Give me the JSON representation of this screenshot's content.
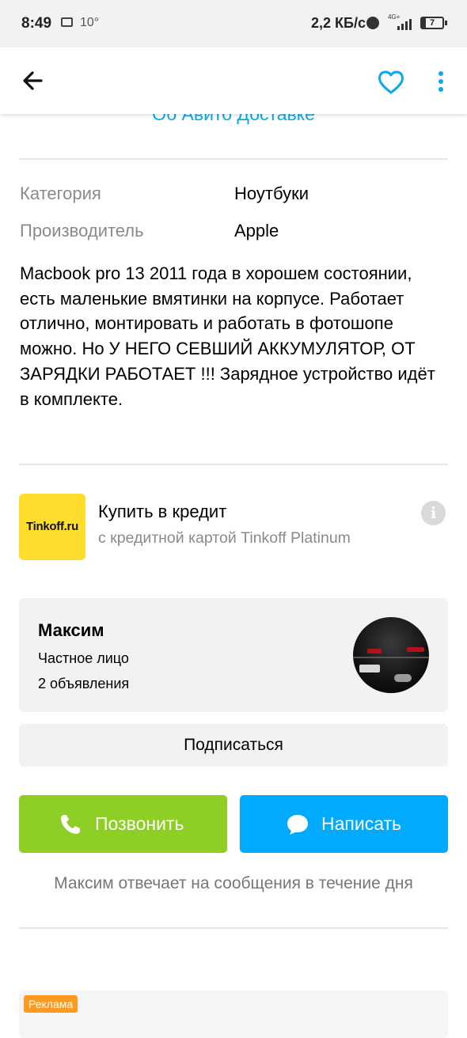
{
  "status_bar": {
    "time": "8:49",
    "temperature": "10°",
    "speed": "2,2 КБ/с",
    "network": "4G+",
    "battery": "7"
  },
  "header": {
    "back_icon": "arrow-left-icon",
    "favorite_icon": "heart-outline-icon",
    "more_icon": "more-vertical-icon",
    "accent_color": "#0aa9e8"
  },
  "delivery_link": "Об Авито Доставке",
  "params": [
    {
      "label": "Категория",
      "value": "Ноутбуки"
    },
    {
      "label": "Производитель",
      "value": "Apple"
    }
  ],
  "description": "Macbook pro 13 2011 года в хорошем состоянии, есть маленькие вмятинки на корпусе. Работает отлично, монтировать и работать в фотошопе можно. Но У НЕГО СЕВШИЙ АККУМУЛЯТОР, ОТ ЗАРЯДКИ РАБОТАЕТ !!! Зарядное устройство идёт в комплекте.",
  "credit": {
    "logo_text": "Tinkoff.ru",
    "title": "Купить в кредит",
    "subtitle": "с кредитной картой Tinkoff Platinum",
    "info_icon": "info-icon",
    "logo_color": "#ffdd2d"
  },
  "seller": {
    "name": "Максим",
    "type": "Частное лицо",
    "ads_count": "2 объявления"
  },
  "actions": {
    "subscribe": "Подписаться",
    "call": "Позвонить",
    "write": "Написать",
    "call_color": "#8dcf25",
    "write_color": "#00aaff"
  },
  "reply_note": "Максим отвечает на сообщения в течение дня",
  "ad_badge": "Реклама"
}
